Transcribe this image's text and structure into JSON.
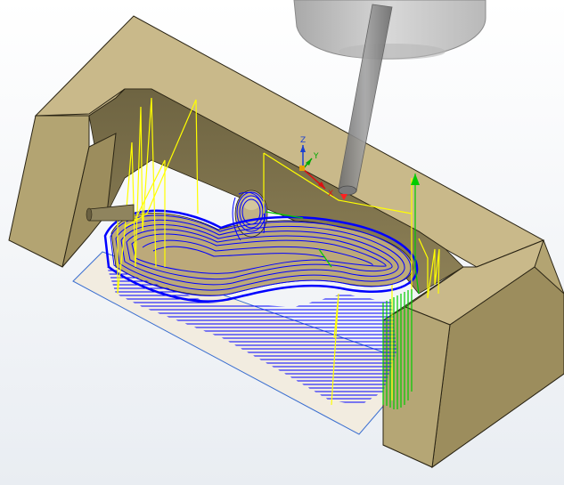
{
  "viewport": {
    "background_top": "#ffffff",
    "background_bottom": "#e9edf2"
  },
  "colors": {
    "stock_top": "#c9b98a",
    "stock_front": "#b3a472",
    "stock_side": "#9c8d5d",
    "stock_inner": "#7f7249",
    "stock_edge": "#2a2414",
    "toolpath_cutting": "#0000ff",
    "toolpath_rapid": "#ffff00",
    "toolpath_lead": "#00cc00",
    "tool_holder": "#c8c8c8",
    "tool_shank": "#8a8a8a",
    "setup_plane": "#f2ece0",
    "setup_plane_edge": "#3b6fd0",
    "part": "#bca97a"
  },
  "view_triad": {
    "x_label": "X",
    "y_label": "Y",
    "z_label": "Z",
    "x_color": "#dd1111",
    "y_color": "#00aa00",
    "z_color": "#1a3fd0"
  },
  "icons": [
    "view-triad-icon",
    "tool-holder-icon",
    "stock-icon",
    "toolpath-icon"
  ]
}
